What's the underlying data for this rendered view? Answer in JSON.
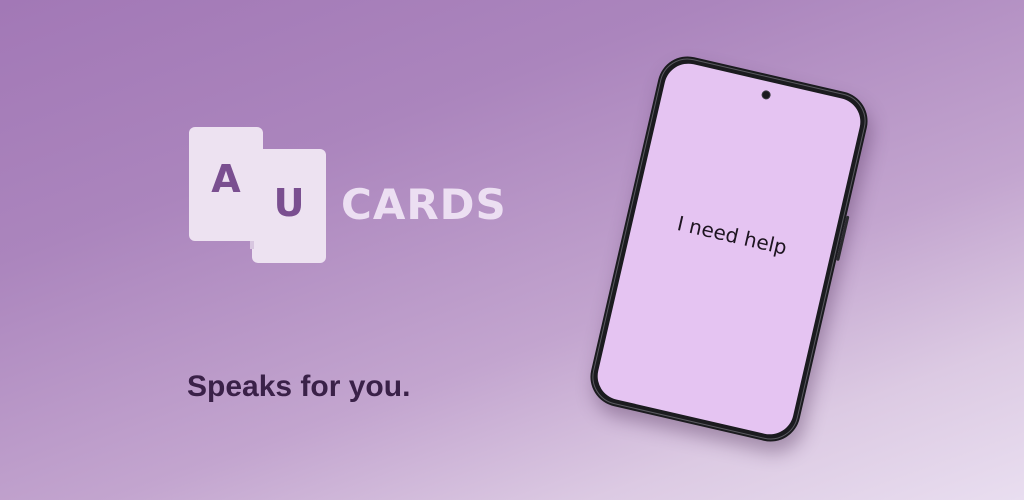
{
  "logo": {
    "card_a_letter": "A",
    "card_u_letter": "U",
    "wordmark": "CARDS"
  },
  "tagline": "Speaks for you.",
  "phone": {
    "screen_text": "I need help"
  },
  "colors": {
    "background_top": "#a278b6",
    "background_bottom": "#e9def0",
    "logo_card": "#ede2f1",
    "logo_letter": "#7a4f90",
    "wordmark": "#ecdff2",
    "tagline": "#3a2148",
    "phone_body": "#1b1b1f",
    "phone_screen": "#e5c4f2"
  }
}
